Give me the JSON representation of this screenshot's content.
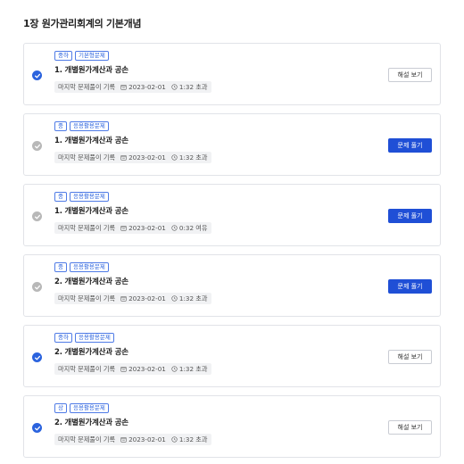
{
  "chapter": {
    "title": "1장 원가관리회계의 기본개념"
  },
  "meta_label": "마지막 문제풀이 기록",
  "icons": {
    "completed": "check-circle-icon",
    "incomplete": "check-circle-gray-icon",
    "date": "calendar-icon",
    "time": "clock-icon"
  },
  "colors": {
    "accent": "#2b63de",
    "button_primary": "#1f4fd6",
    "incomplete": "#b8b8b8"
  },
  "problems": [
    {
      "difficulty": "중하",
      "category": "기본형문제",
      "title": "1. 개별원가계산과 공손",
      "date": "2023-02-01",
      "time": "1:32 초과",
      "status": "done",
      "button": "해설 보기"
    },
    {
      "difficulty": "중",
      "category": "응용활용문제",
      "title": "1. 개별원가계산과 공손",
      "date": "2023-02-01",
      "time": "1:32 초과",
      "status": "todo",
      "button": "문제 풀기"
    },
    {
      "difficulty": "중",
      "category": "응용활용문제",
      "title": "1. 개별원가계산과 공손",
      "date": "2023-02-01",
      "time": "0:32 여유",
      "status": "todo",
      "button": "문제 풀기"
    },
    {
      "difficulty": "중",
      "category": "응용활용문제",
      "title": "2. 개별원가계산과 공손",
      "date": "2023-02-01",
      "time": "1:32 초과",
      "status": "todo",
      "button": "문제 풀기"
    },
    {
      "difficulty": "중하",
      "category": "응용활용문제",
      "title": "2. 개별원가계산과 공손",
      "date": "2023-02-01",
      "time": "1:32 초과",
      "status": "done",
      "button": "해설 보기"
    },
    {
      "difficulty": "상",
      "category": "응용활용문제",
      "title": "2. 개별원가계산과 공손",
      "date": "2023-02-01",
      "time": "1:32 초과",
      "status": "done",
      "button": "해설 보기"
    }
  ]
}
